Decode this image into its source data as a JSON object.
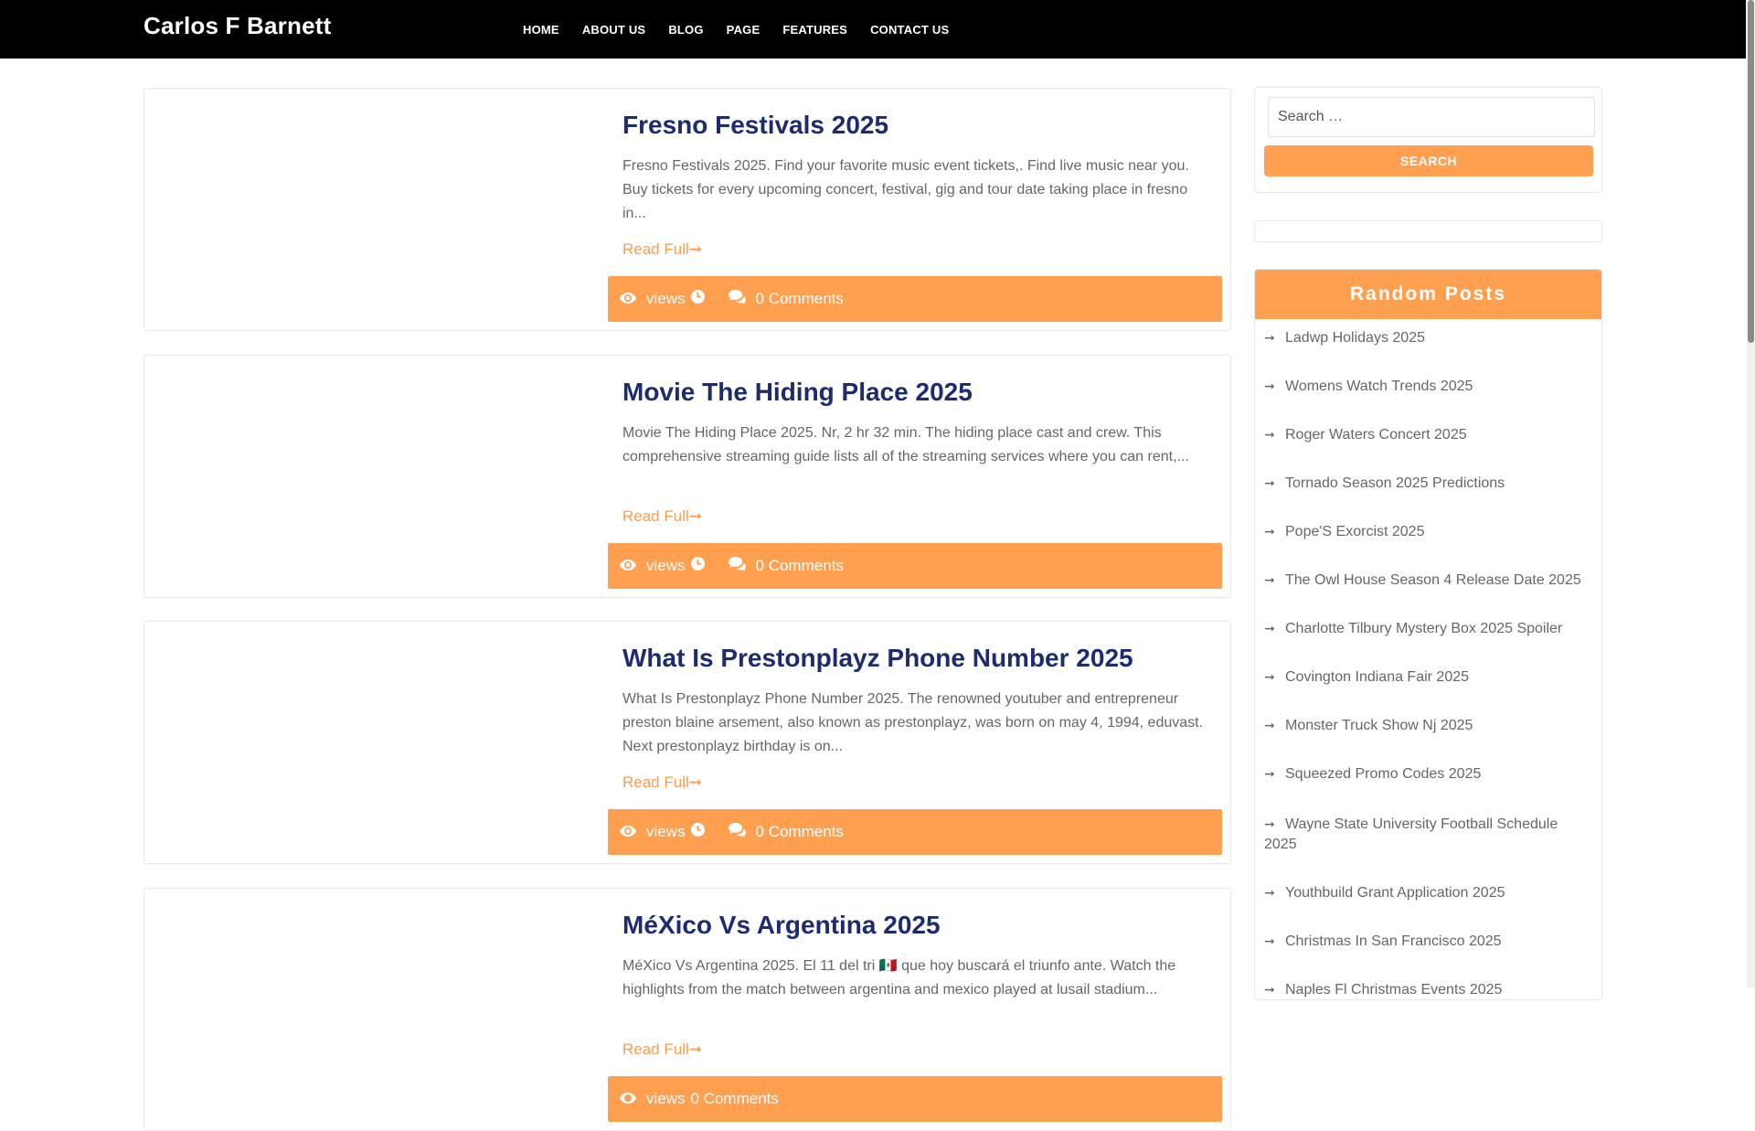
{
  "brand": "Carlos F Barnett",
  "nav": [
    "HOME",
    "ABOUT US",
    "BLOG",
    "PAGE",
    "FEATURES",
    "CONTACT US"
  ],
  "posts": [
    {
      "title": "Fresno Festivals 2025",
      "excerpt": "Fresno Festivals 2025. Find your favorite music event tickets,. Find live music near you. Buy tickets for every upcoming concert, festival, gig and tour date taking place in fresno in...",
      "read_more": "Read Full➞",
      "views_label": "views",
      "comments": "0 Comments"
    },
    {
      "title": "Movie The Hiding Place 2025",
      "excerpt": "Movie The Hiding Place 2025. Nr, 2 hr 32 min. The hiding place cast and crew. This comprehensive streaming guide lists all of the streaming services where you can rent,...",
      "read_more": "Read Full➞",
      "views_label": "views",
      "comments": "0 Comments"
    },
    {
      "title": "What Is Prestonplayz Phone Number 2025",
      "excerpt": "What Is Prestonplayz Phone Number 2025. The renowned youtuber and entrepreneur preston blaine arsement, also known as prestonplayz, was born on may 4, 1994, eduvast. Next prestonplayz birthday is on...",
      "read_more": "Read Full➞",
      "views_label": "views",
      "comments": "0 Comments"
    },
    {
      "title": "MéXico Vs Argentina 2025",
      "excerpt": "MéXico Vs Argentina 2025. El 11 del tri 🇲🇽 que hoy buscará el triunfo ante. Watch the highlights from the match between argentina and mexico played at lusail stadium...",
      "read_more": "Read Full➞",
      "views_label": "views",
      "comments": "0 Comments"
    }
  ],
  "search": {
    "placeholder": "Search …",
    "button": "SEARCH"
  },
  "random_posts": {
    "title": "Random Posts",
    "items": [
      "Ladwp Holidays 2025",
      "Womens Watch Trends 2025",
      "Roger Waters Concert 2025",
      "Tornado Season 2025 Predictions",
      "Pope'S Exorcist 2025",
      "The Owl House Season 4 Release Date 2025",
      "Charlotte Tilbury Mystery Box 2025 Spoiler",
      "Covington Indiana Fair 2025",
      "Monster Truck Show Nj 2025",
      "Squeezed Promo Codes 2025",
      "Wayne State University Football Schedule 2025",
      "Youthbuild Grant Application 2025",
      "Christmas In San Francisco 2025",
      "Naples Fl Christmas Events 2025"
    ]
  },
  "colors": {
    "accent": "#ff9f50",
    "header_bg": "#000000",
    "title": "#1c2c6e"
  },
  "icons": {
    "views": "eye-icon",
    "time": "clock-icon",
    "comments": "comments-icon",
    "list_arrow": "arrow-right-icon"
  }
}
